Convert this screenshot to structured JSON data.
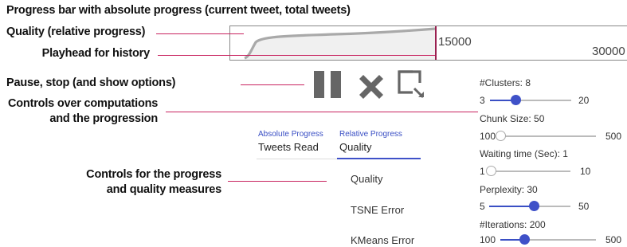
{
  "title": "Progress bar with absolute progress (current tweet, total tweets)",
  "annotations": {
    "quality": "Quality (relative progress)",
    "playhead": "Playhead for history",
    "pause": "Pause, stop (and show options)",
    "controls_line1": "Controls over computations",
    "controls_line2": "and the progression",
    "measures_line1": "Controls for the progress",
    "measures_line2": "and quality measures"
  },
  "progress": {
    "mid_label": "15000",
    "end_label": "30000",
    "fraction": 0.5
  },
  "tabs": {
    "absolute": {
      "small": "Absolute Progress",
      "big": "Tweets Read"
    },
    "relative": {
      "small": "Relative Progress",
      "big": "Quality"
    }
  },
  "measures": [
    "Quality",
    "TSNE Error",
    "KMeans Error"
  ],
  "params": {
    "clusters": {
      "label": "#Clusters: 8",
      "min": "3",
      "max": "20",
      "value": 8
    },
    "chunk": {
      "label": "Chunk Size: 50",
      "min": "100",
      "max": "500",
      "value": 50
    },
    "waiting": {
      "label": "Waiting time (Sec): 1",
      "min": "1",
      "max": "10",
      "value": 1
    },
    "perplexity": {
      "label": "Perplexity: 30",
      "min": "5",
      "max": "50",
      "value": 30
    },
    "iterations": {
      "label": "#Iterations: 200",
      "min": "100",
      "max": "500",
      "value": 200
    }
  },
  "colors": {
    "accent": "#3f51c8",
    "leader": "#c8235f",
    "icon": "#666666"
  },
  "icons": [
    "pause-icon",
    "stop-icon",
    "options-icon"
  ]
}
